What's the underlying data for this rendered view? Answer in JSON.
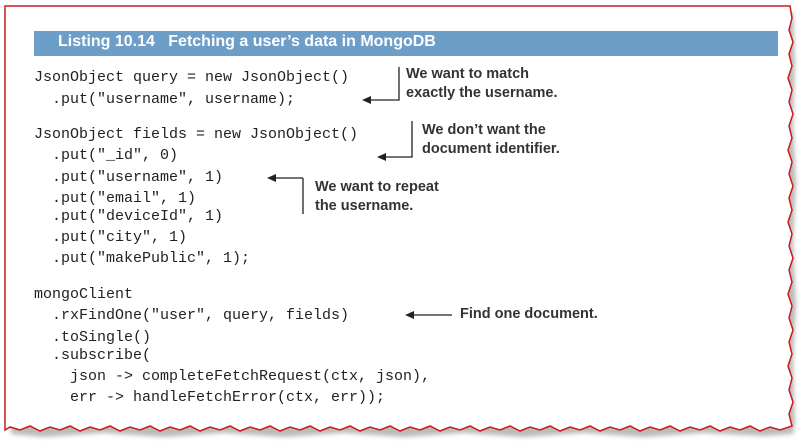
{
  "listing": {
    "label": "Listing 10.14",
    "title": "Fetching a user’s data in MongoDB"
  },
  "code_lines": [
    "JsonObject query = new JsonObject()",
    "  .put(\"username\", username);",
    "JsonObject fields = new JsonObject()",
    "  .put(\"_id\", 0)",
    "  .put(\"username\", 1)",
    "  .put(\"email\", 1)",
    "  .put(\"deviceId\", 1)",
    "  .put(\"city\", 1)",
    "  .put(\"makePublic\", 1);",
    "mongoClient",
    "  .rxFindOne(\"user\", query, fields)",
    "  .toSingle()",
    "  .subscribe(",
    "    json -> completeFetchRequest(ctx, json),",
    "    err -> handleFetchError(ctx, err));"
  ],
  "annotations": [
    {
      "line1": "We want to match",
      "line2": "exactly the username."
    },
    {
      "line1": "We don’t want the",
      "line2": "document identifier."
    },
    {
      "line1": "We want to repeat",
      "line2": "the username."
    },
    {
      "line1": "Find one document.",
      "line2": ""
    }
  ],
  "colors": {
    "header_bg": "#6d9ec7",
    "frame_border": "#cc1a1a"
  }
}
